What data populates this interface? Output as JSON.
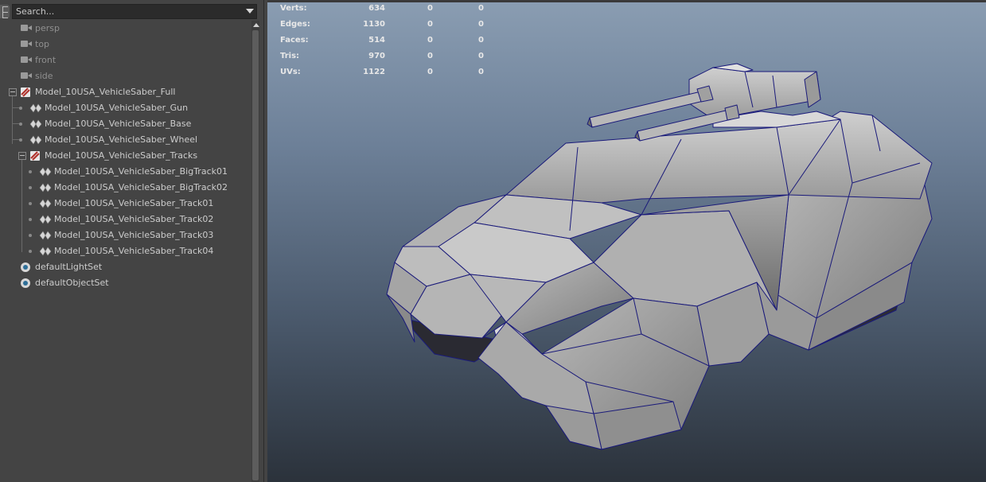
{
  "outliner": {
    "search_placeholder": "Search...",
    "items": [
      {
        "label": "persp",
        "kind": "camera",
        "dim": true
      },
      {
        "label": "top",
        "kind": "camera",
        "dim": true
      },
      {
        "label": "front",
        "kind": "camera",
        "dim": true
      },
      {
        "label": "side",
        "kind": "camera",
        "dim": true
      },
      {
        "label": "Model_10USA_VehicleSaber_Full",
        "kind": "group",
        "dim": false
      },
      {
        "label": "Model_10USA_VehicleSaber_Gun",
        "kind": "mesh",
        "dim": false
      },
      {
        "label": "Model_10USA_VehicleSaber_Base",
        "kind": "mesh",
        "dim": false
      },
      {
        "label": "Model_10USA_VehicleSaber_Wheel",
        "kind": "mesh",
        "dim": false
      },
      {
        "label": "Model_10USA_VehicleSaber_Tracks",
        "kind": "group",
        "dim": false
      },
      {
        "label": "Model_10USA_VehicleSaber_BigTrack01",
        "kind": "mesh",
        "dim": false
      },
      {
        "label": "Model_10USA_VehicleSaber_BigTrack02",
        "kind": "mesh",
        "dim": false
      },
      {
        "label": "Model_10USA_VehicleSaber_Track01",
        "kind": "mesh",
        "dim": false
      },
      {
        "label": "Model_10USA_VehicleSaber_Track02",
        "kind": "mesh",
        "dim": false
      },
      {
        "label": "Model_10USA_VehicleSaber_Track03",
        "kind": "mesh",
        "dim": false
      },
      {
        "label": "Model_10USA_VehicleSaber_Track04",
        "kind": "mesh",
        "dim": false
      },
      {
        "label": "defaultLightSet",
        "kind": "set",
        "dim": false
      },
      {
        "label": "defaultObjectSet",
        "kind": "set",
        "dim": false
      }
    ]
  },
  "hud": {
    "rows": [
      {
        "label": "Verts:",
        "v1": "634",
        "v2": "0",
        "v3": "0"
      },
      {
        "label": "Edges:",
        "v1": "1130",
        "v2": "0",
        "v3": "0"
      },
      {
        "label": "Faces:",
        "v1": "514",
        "v2": "0",
        "v3": "0"
      },
      {
        "label": "Tris:",
        "v1": "970",
        "v2": "0",
        "v3": "0"
      },
      {
        "label": "UVs:",
        "v1": "1122",
        "v2": "0",
        "v3": "0"
      }
    ]
  },
  "colors": {
    "wireframe": "#1a1a7a",
    "mesh_light": "#c4c4c4",
    "mesh_dark": "#7c7c7c"
  }
}
